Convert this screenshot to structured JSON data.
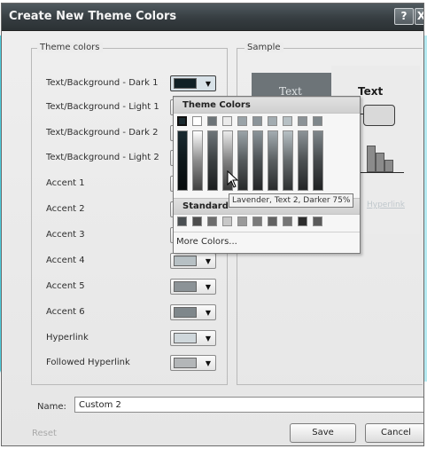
{
  "dialog": {
    "title": "Create New Theme Colors",
    "help_glyph": "?",
    "close_glyph": "X"
  },
  "theme_colors": {
    "group_label": "Theme colors",
    "rows": [
      {
        "label": "Text/Background - Dark 1",
        "color": "#102026"
      },
      {
        "label": "Text/Background - Light 1",
        "color": "#ffffff"
      },
      {
        "label": "Text/Background - Dark 2",
        "color": "#6d7478"
      },
      {
        "label": "Text/Background - Light 2",
        "color": "#ebebeb"
      },
      {
        "label": "Accent 1",
        "color": "#9aa3a8"
      },
      {
        "label": "Accent 2",
        "color": "#8b9499"
      },
      {
        "label": "Accent 3",
        "color": "#a3acb1"
      },
      {
        "label": "Accent 4",
        "color": "#b7c0c4"
      },
      {
        "label": "Accent 5",
        "color": "#8c9397"
      },
      {
        "label": "Accent 6",
        "color": "#7f878b"
      },
      {
        "label": "Hyperlink",
        "color": "#cfd7db"
      },
      {
        "label": "Followed Hyperlink",
        "color": "#b3b6b8"
      }
    ]
  },
  "sample": {
    "group_label": "Sample",
    "dark_text": "Text",
    "light_text": "Text",
    "hyperlink_text": "Hyperlink"
  },
  "dropdown": {
    "theme_header": "Theme Colors",
    "standard_header": "Standard",
    "more_colors": "More Colors...",
    "theme_top_row": [
      "#1a2a30",
      "#ffffff",
      "#6d7478",
      "#ebebeb",
      "#9aa3a8",
      "#8b9499",
      "#a3acb1",
      "#b7c0c4",
      "#8c9397",
      "#7f878b"
    ],
    "standard_row": [
      "#4a4f52",
      "#4d4d4d",
      "#6d6d6d",
      "#c8c8c8",
      "#9a9a9a",
      "#7a7a7a",
      "#626262",
      "#757575",
      "#2d2d2d",
      "#5a5a5a"
    ],
    "tooltip": "Lavender, Text 2, Darker 75%"
  },
  "footer": {
    "name_label": "Name:",
    "name_value": "Custom 2",
    "reset_label": "Reset",
    "save_label": "Save",
    "cancel_label": "Cancel"
  }
}
